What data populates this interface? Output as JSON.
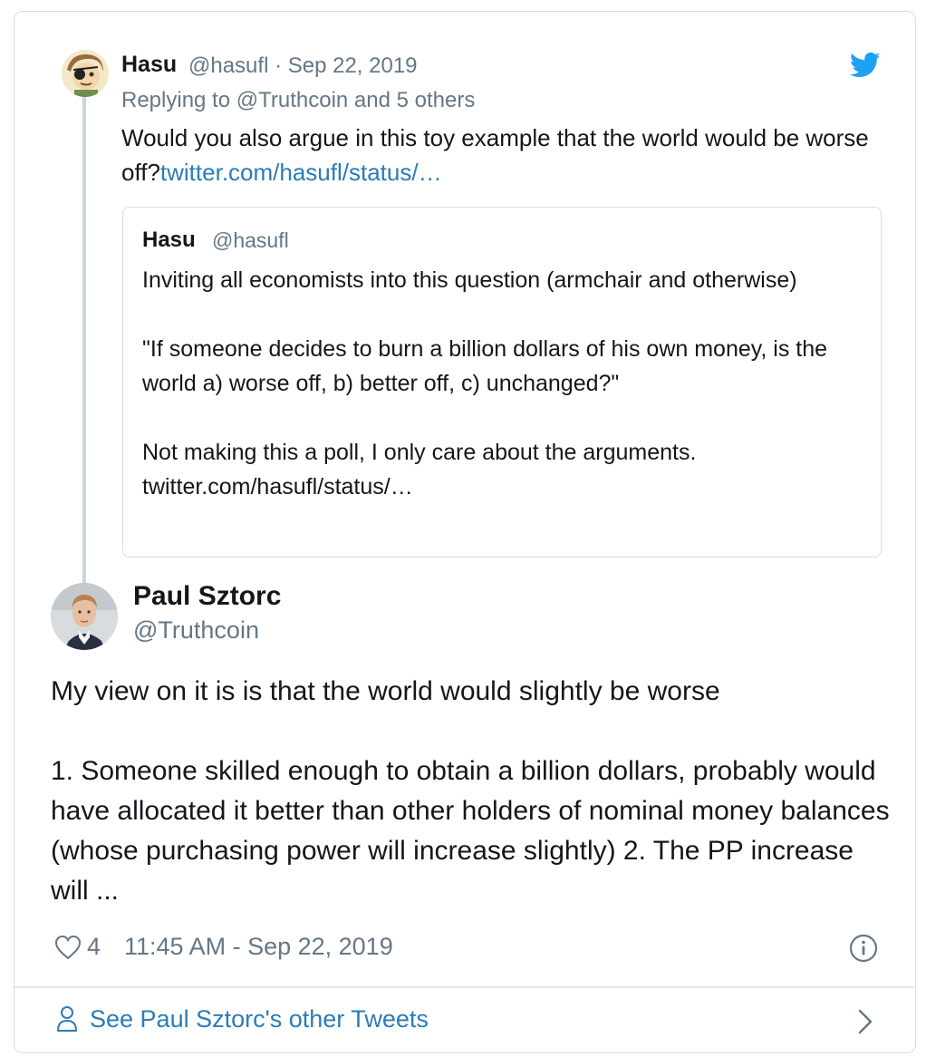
{
  "reply": {
    "name": "Hasu",
    "meta": "@hasufl · Sep 22, 2019",
    "replying_to": "Replying to @Truthcoin and 5 others",
    "text_before_link": "Would you also argue in this toy example that the world would be worse off?",
    "link": "twitter.com/hasufl/status/…"
  },
  "quote": {
    "name": "Hasu",
    "handle": "@hasufl",
    "paragraphs": [
      "Inviting all economists into this question (armchair and otherwise)",
      "\"If someone decides to burn a billion dollars of his own money, is the world a) worse off, b) better off, c) unchanged?\"",
      "Not making this a poll, I only care about the arguments. twitter.com/hasufl/status/…"
    ]
  },
  "main": {
    "name": "Paul Sztorc",
    "handle": "@Truthcoin",
    "paragraph1": "My view on it is is that the world would slightly be worse",
    "paragraph2": "1. Someone skilled enough to obtain a billion dollars, probably would have allocated it better than other holders of nominal money balances (whose purchasing power will increase slightly) 2. The PP increase will ...",
    "likes": "4",
    "timestamp": "11:45 AM - Sep 22, 2019"
  },
  "footer": {
    "label": "See Paul Sztorc's other Tweets"
  },
  "icons": {
    "bird": "twitter-bird-icon",
    "heart": "heart-icon",
    "info": "info-icon",
    "person": "person-icon",
    "chevron": "chevron-right-icon"
  },
  "colors": {
    "text": "#14171a",
    "secondary": "#657786",
    "link": "#2b7bb9",
    "twitter_blue": "#1da1f2",
    "border": "#d6dde3"
  }
}
